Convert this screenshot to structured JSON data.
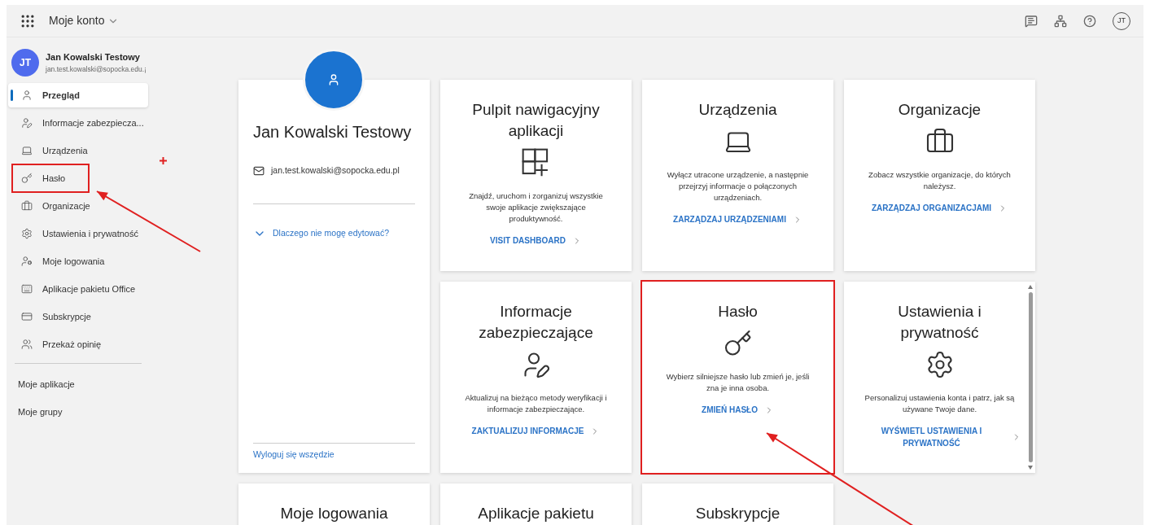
{
  "topbar": {
    "title": "Moje konto",
    "avatar": "JT"
  },
  "sidebar": {
    "user": {
      "initials": "JT",
      "name": "Jan Kowalski Testowy",
      "email": "jan.test.kowalski@sopocka.edu.¡"
    },
    "items": [
      {
        "label": "Przegląd",
        "selected": true,
        "annotated": false
      },
      {
        "label": "Informacje zabezpiecza...",
        "selected": false,
        "annotated": false
      },
      {
        "label": "Urządzenia",
        "selected": false,
        "annotated": false
      },
      {
        "label": "Hasło",
        "selected": false,
        "annotated": true
      },
      {
        "label": "Organizacje",
        "selected": false,
        "annotated": false
      },
      {
        "label": "Ustawienia i prywatność",
        "selected": false,
        "annotated": false
      },
      {
        "label": "Moje logowania",
        "selected": false,
        "annotated": false
      },
      {
        "label": "Aplikacje pakietu Office",
        "selected": false,
        "annotated": false
      },
      {
        "label": "Subskrypcje",
        "selected": false,
        "annotated": false
      },
      {
        "label": "Przekaż opinię",
        "selected": false,
        "annotated": false
      }
    ],
    "links": [
      "Moje aplikacje",
      "Moje grupy"
    ]
  },
  "profile": {
    "name": "Jan Kowalski Testowy",
    "email": "jan.test.kowalski@sopocka.edu.pl",
    "expander": "Dlaczego nie mogę edytować?",
    "signout": "Wyloguj się wszędzie"
  },
  "tiles": [
    {
      "title": "Pulpit nawigacyjny aplikacji",
      "description": "Znajdź, uruchom i zorganizuj wszystkie swoje aplikacje zwiększające produktywność.",
      "link": "VISIT DASHBOARD",
      "annotated": false
    },
    {
      "title": "Urządzenia",
      "description": "Wyłącz utracone urządzenie, a następnie przejrzyj informacje o połączonych urządzeniach.",
      "link": "ZARZĄDZAJ URZĄDZENIAMI",
      "annotated": false
    },
    {
      "title": "Organizacje",
      "description": "Zobacz wszystkie organizacje, do których należysz.",
      "link": "ZARZĄDZAJ ORGANIZACJAMI",
      "annotated": false
    },
    {
      "title": "Informacje zabezpieczające",
      "description": "Aktualizuj na bieżąco metody weryfikacji i informacje zabezpieczające.",
      "link": "ZAKTUALIZUJ INFORMACJE",
      "annotated": false
    },
    {
      "title": "Hasło",
      "description": "Wybierz silniejsze hasło lub zmień je, jeśli zna je inna osoba.",
      "link": "ZMIEŃ HASŁO",
      "annotated": true
    },
    {
      "title": "Ustawienia i prywatność",
      "description": "Personalizuj ustawienia konta i patrz, jak są używane Twoje dane.",
      "link": "WYŚWIETL USTAWIENIA I PRYWATNOŚĆ",
      "annotated": false,
      "scrollable": true
    },
    {
      "title": "Moje logowania",
      "annotated": false
    },
    {
      "title": "Aplikacje pakietu",
      "annotated": false
    },
    {
      "title": "Subskrypcje",
      "annotated": false
    }
  ]
}
